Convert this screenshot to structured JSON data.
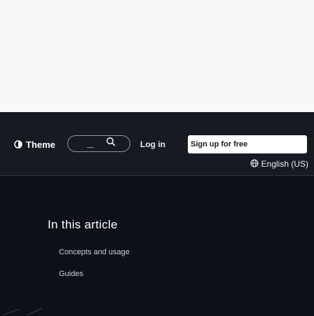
{
  "header": {
    "theme_label": "Theme",
    "login_label": "Log in",
    "signup_label": "Sign up for free",
    "language_label": "English (US)"
  },
  "search": {
    "placeholder": ""
  },
  "article": {
    "heading": "In this article",
    "items": [
      {
        "label": "Concepts and usage"
      },
      {
        "label": "Guides"
      }
    ]
  },
  "icons": {
    "theme": "theme-half-circle-icon",
    "search": "search-icon",
    "language": "globe-icon"
  },
  "colors": {
    "page_background": "#0d1117",
    "header_background": "#161b22",
    "hero_background": "#f6f8fa",
    "signup_background": "#ffffff",
    "text_primary": "#ffffff"
  }
}
